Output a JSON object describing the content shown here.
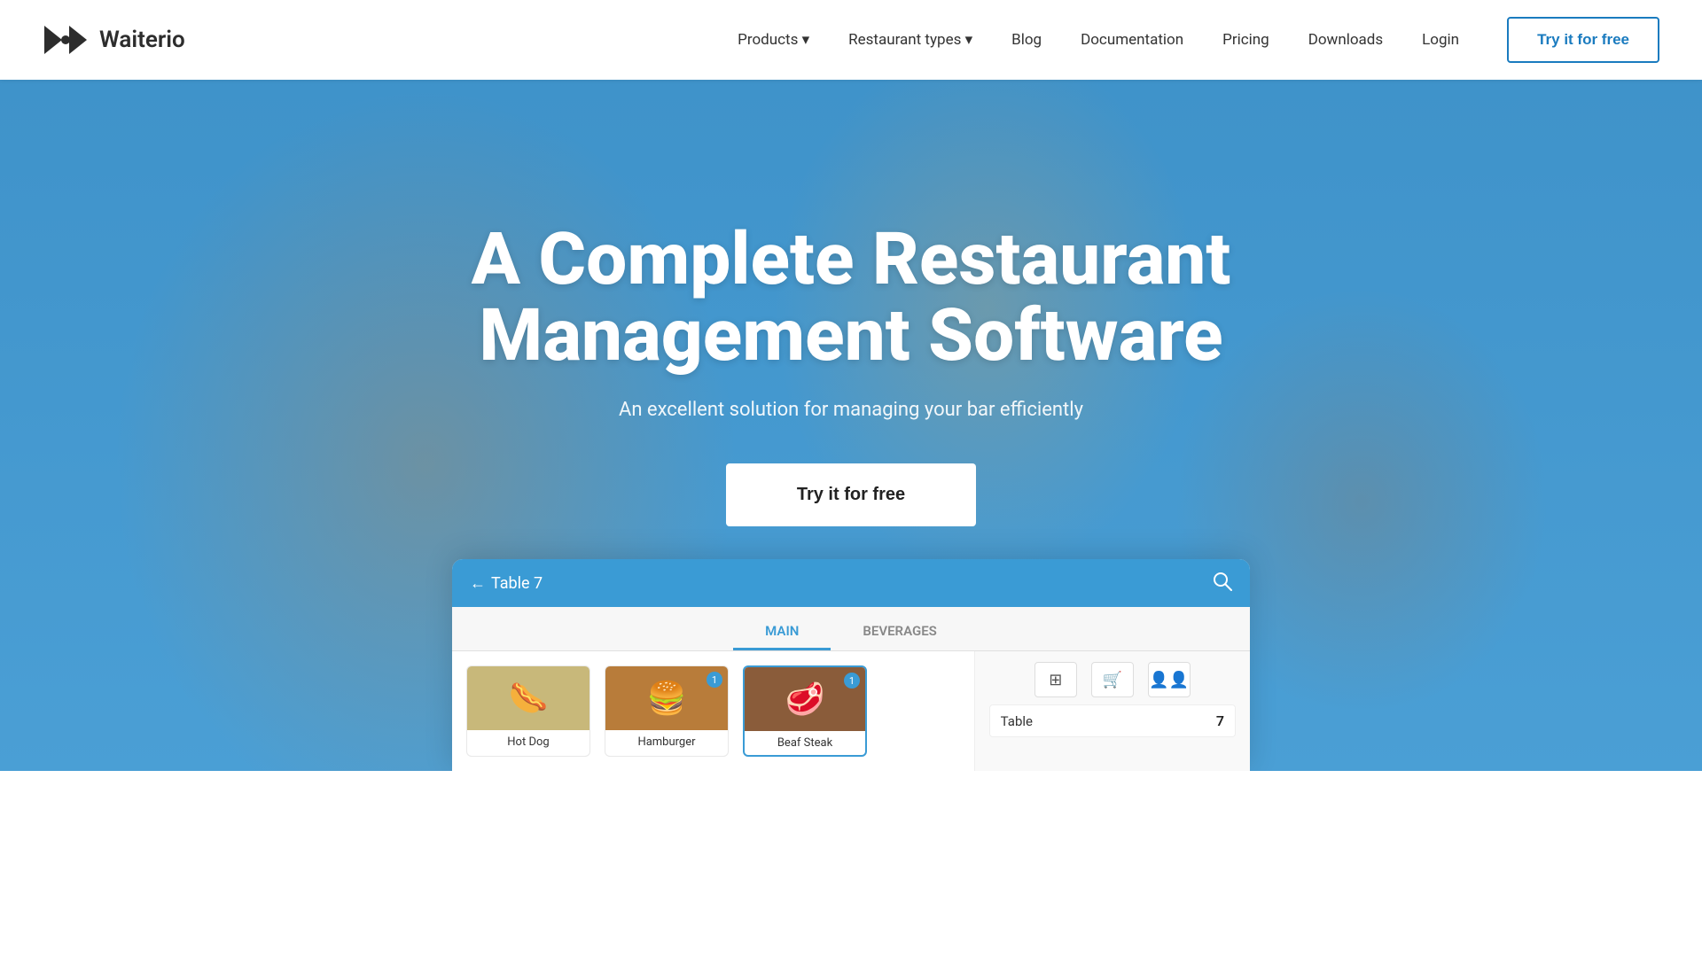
{
  "navbar": {
    "logo_text": "Waiterio",
    "links": [
      {
        "id": "products",
        "label": "Products ▾"
      },
      {
        "id": "restaurant-types",
        "label": "Restaurant types ▾"
      },
      {
        "id": "blog",
        "label": "Blog"
      },
      {
        "id": "documentation",
        "label": "Documentation"
      },
      {
        "id": "pricing",
        "label": "Pricing"
      },
      {
        "id": "downloads",
        "label": "Downloads"
      },
      {
        "id": "login",
        "label": "Login"
      }
    ],
    "cta_label": "Try it for free"
  },
  "hero": {
    "title_line1": "A Complete Restaurant",
    "title_line2": "Management Software",
    "subtitle": "An excellent solution for managing your bar efficiently",
    "cta_label": "Try it for free"
  },
  "app_preview": {
    "bar_back": "←",
    "bar_title": "Table 7",
    "tabs": [
      {
        "id": "main",
        "label": "MAIN",
        "active": true
      },
      {
        "id": "beverages",
        "label": "BEVERAGES",
        "active": false
      }
    ],
    "items": [
      {
        "id": "hotdog",
        "label": "Hot Dog",
        "emoji": "🌭",
        "bg": "#c8b86a",
        "badge": null
      },
      {
        "id": "hamburger",
        "label": "Hamburger",
        "emoji": "🍔",
        "bg": "#c07a3a",
        "badge": "1"
      },
      {
        "id": "beafsteak",
        "label": "Beaf Steak",
        "emoji": "🥩",
        "bg": "#8a5030",
        "badge": "1",
        "selected": true
      }
    ],
    "right_icons": [
      "⊞",
      "🛒",
      "👥"
    ],
    "table_label": "Table",
    "table_num": "7"
  }
}
